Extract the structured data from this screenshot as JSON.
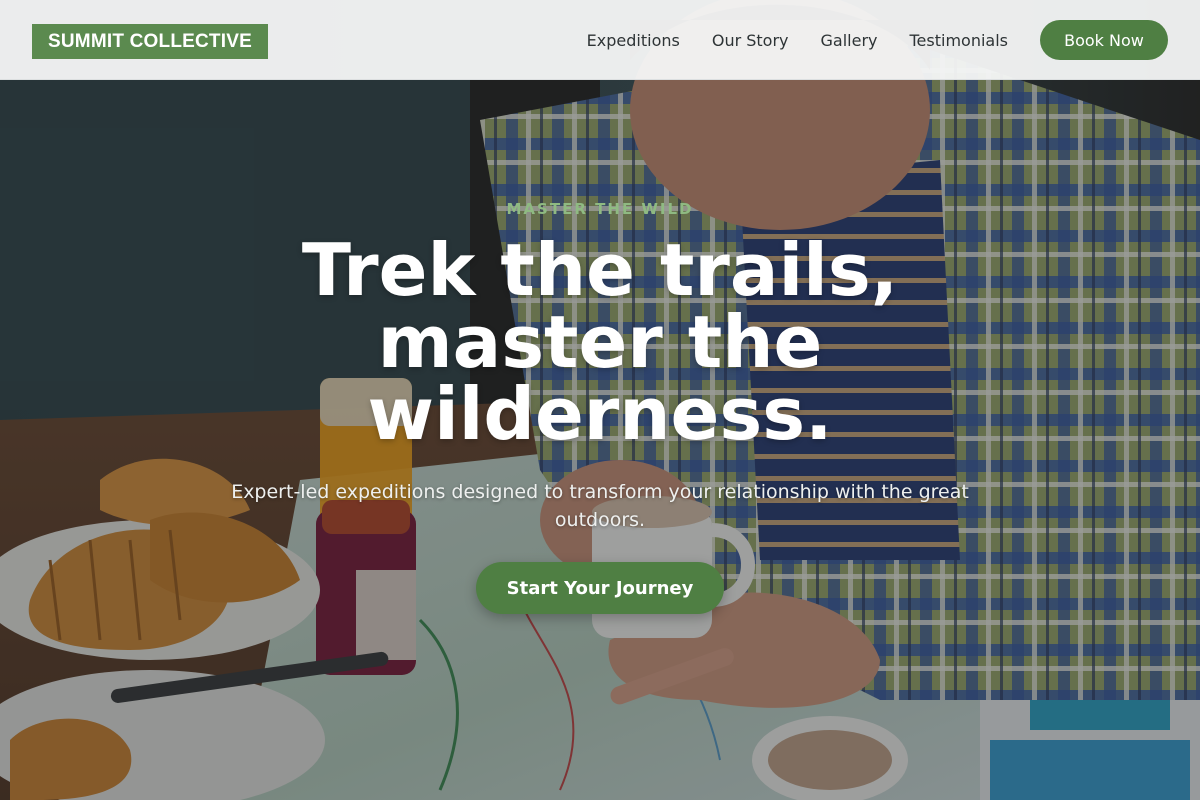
{
  "brand": {
    "name": "SUMMIT COLLECTIVE"
  },
  "nav": {
    "links": [
      {
        "label": "Expeditions"
      },
      {
        "label": "Our Story"
      },
      {
        "label": "Gallery"
      },
      {
        "label": "Testimonials"
      }
    ],
    "cta_label": "Book Now"
  },
  "hero": {
    "eyebrow": "MASTER THE WILD",
    "headline": "Trek the trails, master the wilderness.",
    "subheadline": "Expert-led expeditions designed to transform your relationship with the great outdoors.",
    "cta_label": "Start Your Journey",
    "background": "man reading a trail map at a breakfast table with croissants, jam and coffee"
  },
  "colors": {
    "brand_green": "#5b8a4f",
    "button_green": "#4f7f43",
    "eyebrow_green": "#8fba82",
    "nav_background": "#f6f7f7",
    "nav_text": "#2e3436"
  }
}
